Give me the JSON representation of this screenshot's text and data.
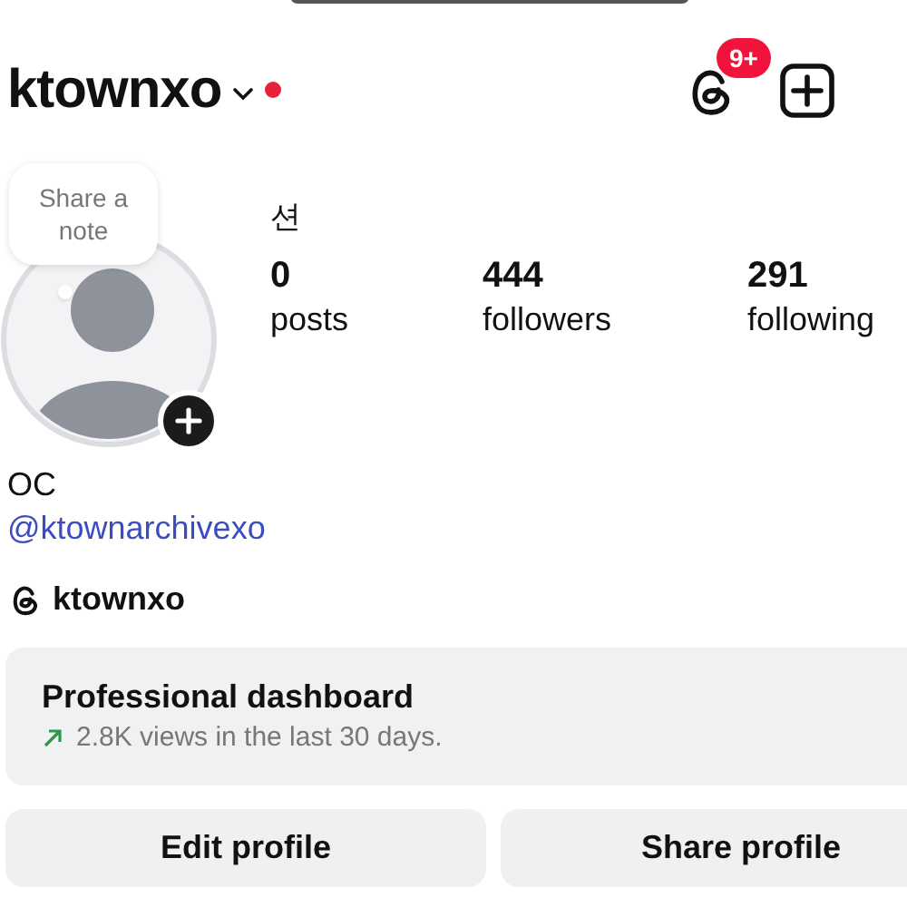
{
  "header": {
    "username": "ktownxo",
    "has_new": true,
    "notification_badge": "9+"
  },
  "note_bubble": {
    "text": "Share a note"
  },
  "profile": {
    "name": "션",
    "bio": "OC",
    "link": "@ktownarchivexo",
    "threads_handle": "ktownxo"
  },
  "stats": [
    {
      "value": "0",
      "label": "posts"
    },
    {
      "value": "444",
      "label": "followers"
    },
    {
      "value": "291",
      "label": "following"
    }
  ],
  "dashboard": {
    "title": "Professional dashboard",
    "subtitle": "2.8K views in the last 30 days."
  },
  "buttons": [
    "Edit profile",
    "Share profile"
  ]
}
